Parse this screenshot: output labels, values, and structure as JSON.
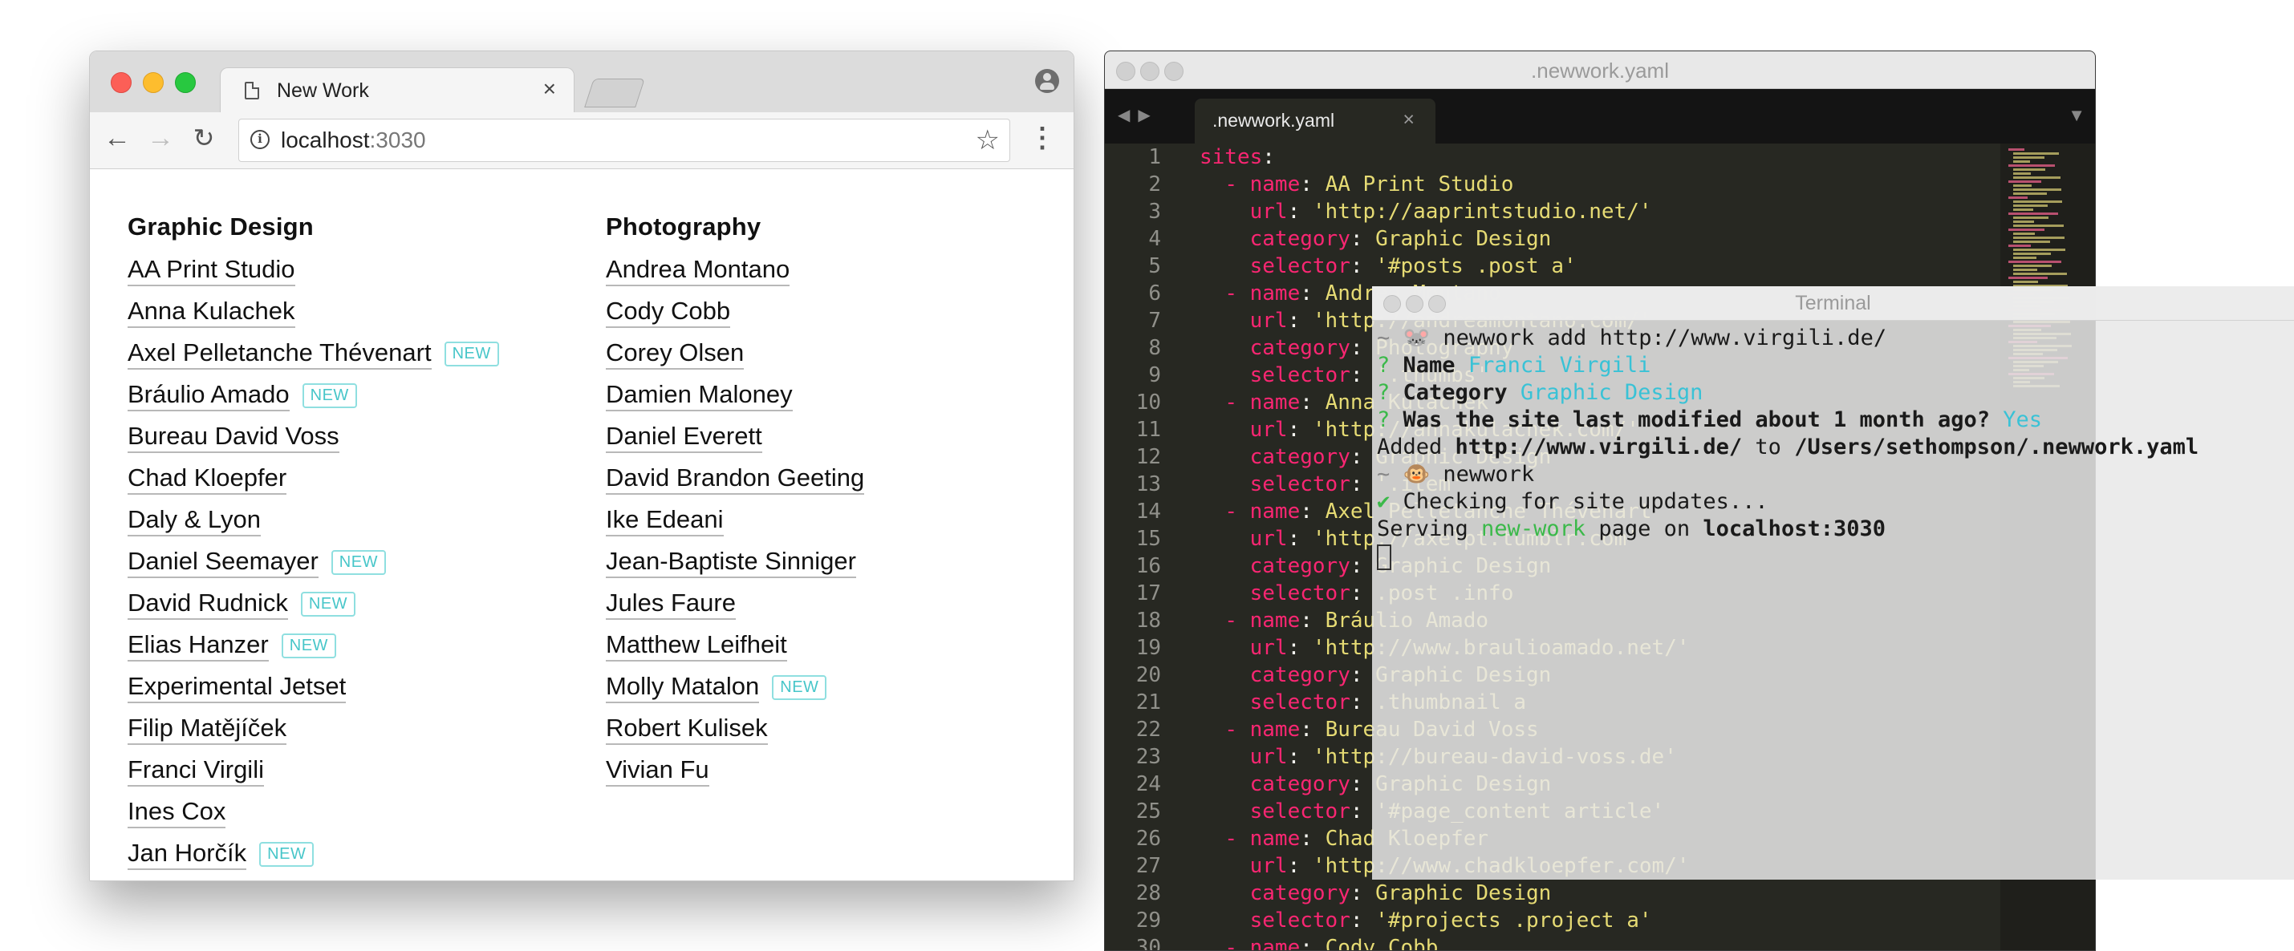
{
  "browser": {
    "tab_title": "New Work",
    "tab_close": "×",
    "url_host": "localhost",
    "url_port": ":3030",
    "columns": [
      {
        "heading": "Graphic Design",
        "items": [
          {
            "label": "AA Print Studio",
            "new": ""
          },
          {
            "label": "Anna Kulachek",
            "new": ""
          },
          {
            "label": "Axel Pelletanche Thévenart",
            "new": "NEW"
          },
          {
            "label": "Bráulio Amado",
            "new": "NEW"
          },
          {
            "label": "Bureau David Voss",
            "new": ""
          },
          {
            "label": "Chad Kloepfer",
            "new": ""
          },
          {
            "label": "Daly & Lyon",
            "new": ""
          },
          {
            "label": "Daniel Seemayer",
            "new": "NEW"
          },
          {
            "label": "David Rudnick",
            "new": "NEW"
          },
          {
            "label": "Elias Hanzer",
            "new": "NEW"
          },
          {
            "label": "Experimental Jetset",
            "new": ""
          },
          {
            "label": "Filip Matějíček",
            "new": ""
          },
          {
            "label": "Franci Virgili",
            "new": ""
          },
          {
            "label": "Ines Cox",
            "new": ""
          },
          {
            "label": "Jan Horčík",
            "new": "NEW"
          }
        ]
      },
      {
        "heading": "Photography",
        "items": [
          {
            "label": "Andrea Montano",
            "new": ""
          },
          {
            "label": "Cody Cobb",
            "new": ""
          },
          {
            "label": "Corey Olsen",
            "new": ""
          },
          {
            "label": "Damien Maloney",
            "new": ""
          },
          {
            "label": "Daniel Everett",
            "new": ""
          },
          {
            "label": "David Brandon Geeting",
            "new": ""
          },
          {
            "label": "Ike Edeani",
            "new": ""
          },
          {
            "label": "Jean-Baptiste Sinniger",
            "new": ""
          },
          {
            "label": "Jules Faure",
            "new": ""
          },
          {
            "label": "Matthew Leifheit",
            "new": ""
          },
          {
            "label": "Molly Matalon",
            "new": "NEW"
          },
          {
            "label": "Robert Kulisek",
            "new": ""
          },
          {
            "label": "Vivian Fu",
            "new": ""
          }
        ]
      }
    ]
  },
  "editor": {
    "window_title": ".newwork.yaml",
    "tab_name": ".newwork.yaml",
    "tab_close": "×",
    "lines": [
      {
        "n": "1",
        "indent": "",
        "dash": "",
        "key": "sites",
        "val": ""
      },
      {
        "n": "2",
        "indent": "  ",
        "dash": "- ",
        "key": "name",
        "val": "AA Print Studio"
      },
      {
        "n": "3",
        "indent": "    ",
        "dash": "",
        "key": "url",
        "val": "'http://aaprintstudio.net/'"
      },
      {
        "n": "4",
        "indent": "    ",
        "dash": "",
        "key": "category",
        "val": "Graphic Design"
      },
      {
        "n": "5",
        "indent": "    ",
        "dash": "",
        "key": "selector",
        "val": "'#posts .post a'"
      },
      {
        "n": "6",
        "indent": "  ",
        "dash": "- ",
        "key": "name",
        "val": "Andrea Montano"
      },
      {
        "n": "7",
        "indent": "    ",
        "dash": "",
        "key": "url",
        "val": "'http://andreamontano.com/'"
      },
      {
        "n": "8",
        "indent": "    ",
        "dash": "",
        "key": "category",
        "val": "Photography"
      },
      {
        "n": "9",
        "indent": "    ",
        "dash": "",
        "key": "selector",
        "val": "'.thumbs'"
      },
      {
        "n": "10",
        "indent": "  ",
        "dash": "- ",
        "key": "name",
        "val": "Anna Kulachek"
      },
      {
        "n": "11",
        "indent": "    ",
        "dash": "",
        "key": "url",
        "val": "'http://annakulachek.com/'"
      },
      {
        "n": "12",
        "indent": "    ",
        "dash": "",
        "key": "category",
        "val": "Graphic Design"
      },
      {
        "n": "13",
        "indent": "    ",
        "dash": "",
        "key": "selector",
        "val": "'.item'"
      },
      {
        "n": "14",
        "indent": "  ",
        "dash": "- ",
        "key": "name",
        "val": "Axel Pelletanche Thévenart"
      },
      {
        "n": "15",
        "indent": "    ",
        "dash": "",
        "key": "url",
        "val": "'http://axelpt.tumblr.com'"
      },
      {
        "n": "16",
        "indent": "    ",
        "dash": "",
        "key": "category",
        "val": "Graphic Design"
      },
      {
        "n": "17",
        "indent": "    ",
        "dash": "",
        "key": "selector",
        "val": ".post .info"
      },
      {
        "n": "18",
        "indent": "  ",
        "dash": "- ",
        "key": "name",
        "val": "Bráulio Amado"
      },
      {
        "n": "19",
        "indent": "    ",
        "dash": "",
        "key": "url",
        "val": "'http://www.braulioamado.net/'"
      },
      {
        "n": "20",
        "indent": "    ",
        "dash": "",
        "key": "category",
        "val": "Graphic Design"
      },
      {
        "n": "21",
        "indent": "    ",
        "dash": "",
        "key": "selector",
        "val": ".thumbnail a"
      },
      {
        "n": "22",
        "indent": "  ",
        "dash": "- ",
        "key": "name",
        "val": "Bureau David Voss"
      },
      {
        "n": "23",
        "indent": "    ",
        "dash": "",
        "key": "url",
        "val": "'http://bureau-david-voss.de'"
      },
      {
        "n": "24",
        "indent": "    ",
        "dash": "",
        "key": "category",
        "val": "Graphic Design"
      },
      {
        "n": "25",
        "indent": "    ",
        "dash": "",
        "key": "selector",
        "val": "'#page_content article'"
      },
      {
        "n": "26",
        "indent": "  ",
        "dash": "- ",
        "key": "name",
        "val": "Chad Kloepfer"
      },
      {
        "n": "27",
        "indent": "    ",
        "dash": "",
        "key": "url",
        "val": "'http://www.chadkloepfer.com/'"
      },
      {
        "n": "28",
        "indent": "    ",
        "dash": "",
        "key": "category",
        "val": "Graphic Design"
      },
      {
        "n": "29",
        "indent": "    ",
        "dash": "",
        "key": "selector",
        "val": "'#projects .project a'"
      },
      {
        "n": "30",
        "indent": "  ",
        "dash": "- ",
        "key": "name",
        "val": "Cody Cobb"
      }
    ]
  },
  "terminal": {
    "title": "Terminal",
    "lines": [
      {
        "html": "<span class=\"gray-t\">~</span> 🐭 newwork add http://www.virgili.de/"
      },
      {
        "html": "<span class=\"green-t\">?</span> <b>Name</b> <span class=\"cyan-t\">Franci Virgili</span>"
      },
      {
        "html": "<span class=\"green-t\">?</span> <b>Category</b> <span class=\"cyan-t\">Graphic Design</span>"
      },
      {
        "html": "<span class=\"green-t\">?</span> <b>Was the site last modified about 1 month ago?</b> <span class=\"cyan-t\">Yes</span>"
      },
      {
        "html": "Added <b>http://www.virgili.de/</b> to <b>/Users/sethompson/.newwork.yaml</b>"
      },
      {
        "html": "<span class=\"gray-t\">~</span> 🐵 newwork"
      },
      {
        "html": "<span class=\"green-t\">✔</span> Checking for site updates..."
      },
      {
        "html": "Serving <span class=\"green-t\">new-work</span> page on <b>localhost:3030</b>"
      },
      {
        "html": "<span class=\"cursor\"></span>"
      }
    ]
  },
  "colors": {
    "accent_new": "#47c6c9",
    "editor_bg": "#272822",
    "yaml_key": "#f92672",
    "yaml_value": "#e6db74"
  },
  "icons": {
    "back": "arrow-left-icon",
    "forward": "arrow-right-icon",
    "reload": "reload-icon",
    "info": "info-icon",
    "bookmark": "star-icon",
    "menu": "kebab-menu-icon",
    "profile": "profile-icon",
    "page": "page-icon"
  }
}
